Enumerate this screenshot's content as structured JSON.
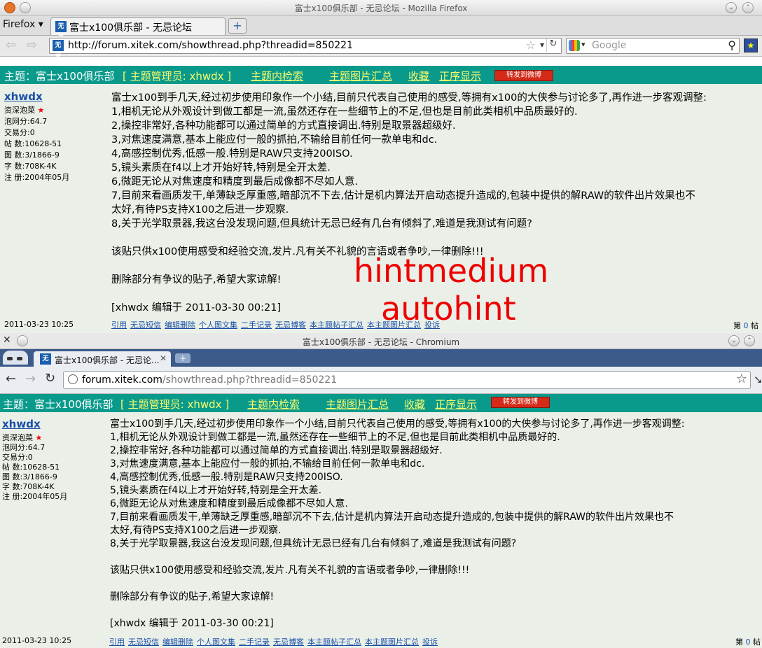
{
  "firefox": {
    "window_title": "富士x100俱乐部 - 无忌论坛 - Mozilla Firefox",
    "menu_label": "Firefox",
    "tab_title": "富士x100俱乐部 - 无忌论坛",
    "url": "http://forum.xitek.com/showthread.php?threadid=850221",
    "search_placeholder": "Google"
  },
  "chromium": {
    "window_title": "富士x100俱乐部 - 无忌论坛 - Chromium",
    "tab_title": "富士x100俱乐部 - 无忌论...",
    "url_host": "forum.xitek.com",
    "url_path": "/showthread.php?threadid=850221"
  },
  "topic": {
    "label": "主题：富士x100俱乐部",
    "admin": "[ 主题管理员: xhwdx ]",
    "links": [
      "主题内检索",
      "主题图片汇总",
      "收藏",
      "正序显示"
    ],
    "weibo": "转发到微博"
  },
  "author": {
    "name": "xhwdx",
    "rank": "资深泡菜",
    "score": "泡网分:64.7",
    "trade": "交易分:0",
    "posts": "帖    数:10628-51",
    "images": "图    数:3/1866-9",
    "chars": "字    数:708K-4K",
    "registered": "注    册:2004年05月"
  },
  "post": {
    "lines": [
      "富士x100到手几天,经过初步使用印象作一个小结,目前只代表自己使用的感受,等拥有x100的大侠参与讨论多了,再作进一步客观调整:",
      "1,相机无论从外观设计到做工都是一流,虽然还存在一些细节上的不足,但也是目前此类相机中品质最好的.",
      "2,操控非常好,各种功能都可以通过简单的方式直接调出.特别是取景器超级好.",
      "3,对焦速度满意,基本上能应付一般的抓拍,不输给目前任何一款单电和dc.",
      "4,高感控制优秀,低感一般.特别是RAW只支持200ISO.",
      "5,镜头素质在f4以上才开始好转,特别是全开太差.",
      "6,微距无论从对焦速度和精度到最后成像都不尽如人意.",
      "7,目前来看画质发干,单薄缺乏厚重感,暗部沉不下去,估计是机内算法开启动态提升造成的,包装中提供的解RAW的软件出片效果也不",
      "太好,有待PS支持X100之后进一步观察.",
      "8,关于光学取景器,我这台没发现问题,但具统计无忌已经有几台有倾斜了,难道是我测试有问题?",
      "",
      "该贴只供x100使用感受和经验交流,发片.凡有关不礼貌的言语或者争吵,一律删除!!!",
      "",
      "删除部分有争议的贴子,希望大家谅解!",
      "",
      "[xhwdx 编辑于 2011-03-30 00:21]"
    ],
    "date": "2011-03-23 10:25",
    "footer_links": [
      "引用",
      "无忌短信",
      "编辑删除",
      "个人图文集",
      "二手记录",
      "无忌博客",
      "本主题帖子汇总",
      "本主题图片汇总",
      "投诉"
    ],
    "floor_prefix": "第",
    "floor_num": "0",
    "floor_suffix": "帖"
  },
  "overlay": {
    "line1": "hintmedium",
    "line2": "autohint"
  }
}
